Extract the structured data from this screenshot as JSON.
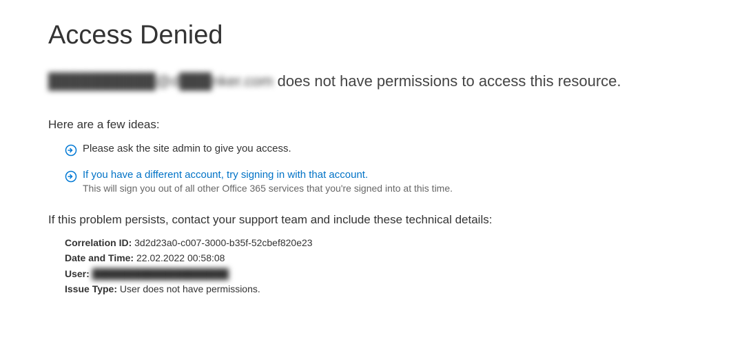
{
  "title": "Access Denied",
  "subtitle_email_obscured": "██████████@d███nker.com",
  "subtitle_rest": " does not have permissions to access this resource.",
  "ideas_heading": "Here are a few ideas:",
  "idea1_text": "Please ask the site admin to give you access.",
  "idea2_link": "If you have a different account, try signing in with that account.",
  "idea2_subtext": "This will sign you out of all other Office 365 services that you're signed into at this time.",
  "persist_heading": "If this problem persists, contact your support team and include these technical details:",
  "tech": {
    "correlation_label": "Correlation ID:",
    "correlation_value": "3d2d23a0-c007-3000-b35f-52cbef820e23",
    "datetime_label": "Date and Time:",
    "datetime_value": "22.02.2022 00:58:08",
    "user_label": "User:",
    "user_value_obscured": "████████████████████",
    "issue_label": "Issue Type:",
    "issue_value": "User does not have permissions."
  }
}
